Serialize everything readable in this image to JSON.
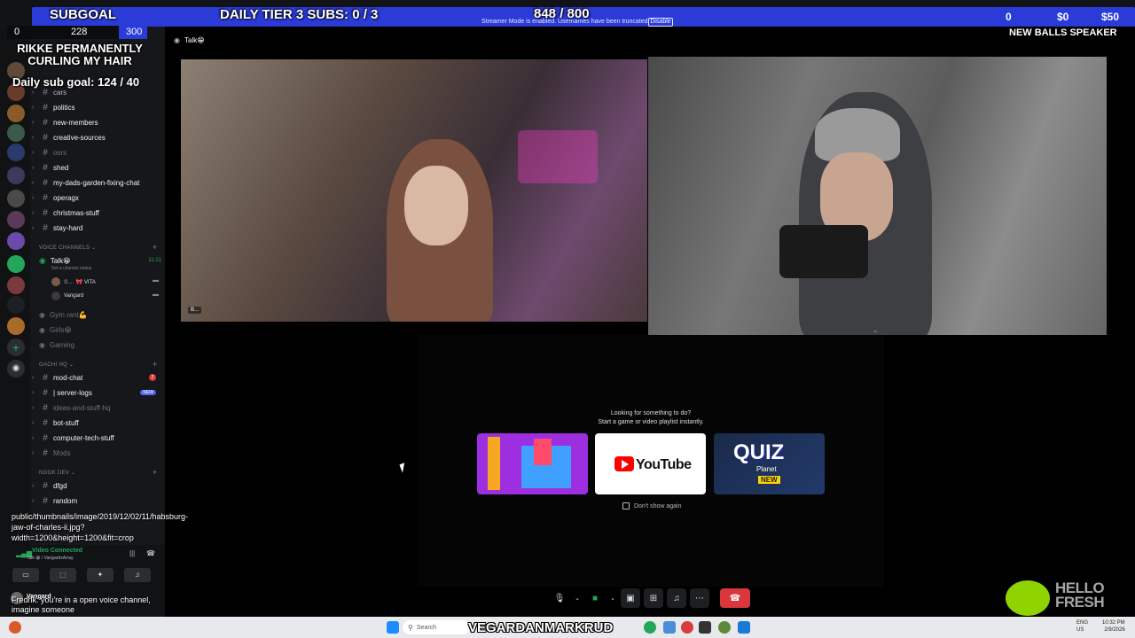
{
  "overlay": {
    "subgoal": "SUBGOAL",
    "daily_tier": "DAILY TIER 3 SUBS: 0 / 3",
    "counter": "848 / 800",
    "streamer_mode": "Streamer Mode is enabled. Usernames have been truncated.",
    "disable": "Disable",
    "money_count": "0",
    "money_a": "$0",
    "money_b": "$50",
    "balls_speaker": "NEW BALLS SPEAKER",
    "num_left": "0",
    "num_mid": "228",
    "num_right": "300",
    "rikke": "RIKKE PERMANENTLY CURLING MY HAIR",
    "daily_sub": "Daily sub goal: 124 / 40",
    "url": "public/thumbnails/image/2019/12/02/11/habsburg-jaw-of-charles-ii.jpg?width=1200&height=1200&fit=crop",
    "chat": "Fredrik: you're in a open voice channel, imagine someone",
    "hellofresh": "HELLO FRESH",
    "streamer_name": "VEGARDANMARKRUD"
  },
  "sidebar": {
    "channels_top": [
      {
        "name": "cars",
        "style": "normal"
      },
      {
        "name": "politics",
        "style": "bright"
      },
      {
        "name": "new-members",
        "style": "bright"
      },
      {
        "name": "creative-sources",
        "style": "bright"
      },
      {
        "name": "osrs",
        "style": "muted"
      },
      {
        "name": "shed",
        "style": "bright"
      },
      {
        "name": "my-dads-garden-fixing-chat",
        "style": "bright"
      },
      {
        "name": "operagx",
        "style": "bright"
      },
      {
        "name": "christmas-stuff",
        "style": "bright"
      },
      {
        "name": "stay-hard",
        "style": "bright"
      }
    ],
    "voice_category": "Voice Channels",
    "voice_channel_talk": "Talk😁",
    "voice_timer": "11:21",
    "voice_status": "Set a channel status",
    "voice_users": [
      "🎀 VITA",
      "Vangard"
    ],
    "voice_others": [
      "Gym rant💪",
      "Girls😁",
      "Gaming"
    ],
    "gachi_category": "GACHI HQ",
    "gachi_channels": [
      {
        "name": "mod-chat",
        "badge": "2"
      },
      {
        "name": "| server-logs",
        "badge": "NEW"
      },
      {
        "name": "ideas-and-stuff-hq",
        "badge": ""
      },
      {
        "name": "bot-stuff",
        "badge": ""
      },
      {
        "name": "computer-tech-stuff",
        "badge": ""
      },
      {
        "name": "Mods",
        "badge": ""
      }
    ],
    "nook_category": "NOOK DEV",
    "nook_channels": [
      "dfgd",
      "random"
    ]
  },
  "user_panel": {
    "video_connected": "Video Connected",
    "location": "Talk 😁 / VangardxArray",
    "username": "Vangard"
  },
  "call": {
    "title": "Talk😁",
    "tile_label": "B...",
    "activity_line1": "Looking for something to do?",
    "activity_line2": "Start a game or video playlist instantly.",
    "youtube": "YouTube",
    "quiz": "QUIZ",
    "quiz_planet": "Planet",
    "quiz_new": "NEW",
    "dont_show": "Don't show again"
  },
  "taskbar": {
    "search": "Search",
    "lang": "ENG US",
    "time": "10:32 PM",
    "date": "2/9/2026"
  },
  "colors": {
    "accent": "#2b3bd8",
    "online": "#23a55a",
    "danger": "#da373c",
    "blurple": "#5865f2"
  }
}
